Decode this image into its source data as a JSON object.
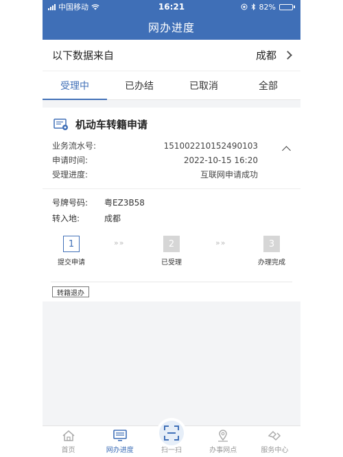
{
  "status_bar": {
    "carrier": "中国移动",
    "time": "16:21",
    "battery": "82%",
    "battery_level": 0.82
  },
  "nav": {
    "title": "网办进度"
  },
  "source": {
    "label": "以下数据来自",
    "city": "成都"
  },
  "tabs": [
    {
      "label": "受理中",
      "active": true
    },
    {
      "label": "已办结",
      "active": false
    },
    {
      "label": "已取消",
      "active": false
    },
    {
      "label": "全部",
      "active": false
    }
  ],
  "card": {
    "title": "机动车转籍申请",
    "info": [
      {
        "key": "业务流水号:",
        "value": "151002210152490103"
      },
      {
        "key": "申请时间:",
        "value": "2022-10-15 16:20"
      },
      {
        "key": "受理进度:",
        "value": "互联网申请成功"
      }
    ],
    "plate": [
      {
        "key": "号牌号码:",
        "value": "粤EZ3B58"
      },
      {
        "key": "转入地:",
        "value": "成都"
      }
    ],
    "steps": [
      {
        "num": "1",
        "label": "提交申请",
        "active": true
      },
      {
        "num": "2",
        "label": "已受理",
        "active": false
      },
      {
        "num": "3",
        "label": "办理完成",
        "active": false
      }
    ],
    "step_arrows": "»»",
    "tag": "转籍退办"
  },
  "tabbar": [
    {
      "label": "首页",
      "icon": "home-icon",
      "active": false
    },
    {
      "label": "网办进度",
      "icon": "monitor-icon",
      "active": true
    },
    {
      "label": "扫一扫",
      "icon": "scan-icon",
      "active": false
    },
    {
      "label": "办事网点",
      "icon": "location-icon",
      "active": false
    },
    {
      "label": "服务中心",
      "icon": "service-icon",
      "active": false
    }
  ],
  "colors": {
    "primary": "#3f6fb7",
    "inactive_step": "#d6d6d6"
  }
}
